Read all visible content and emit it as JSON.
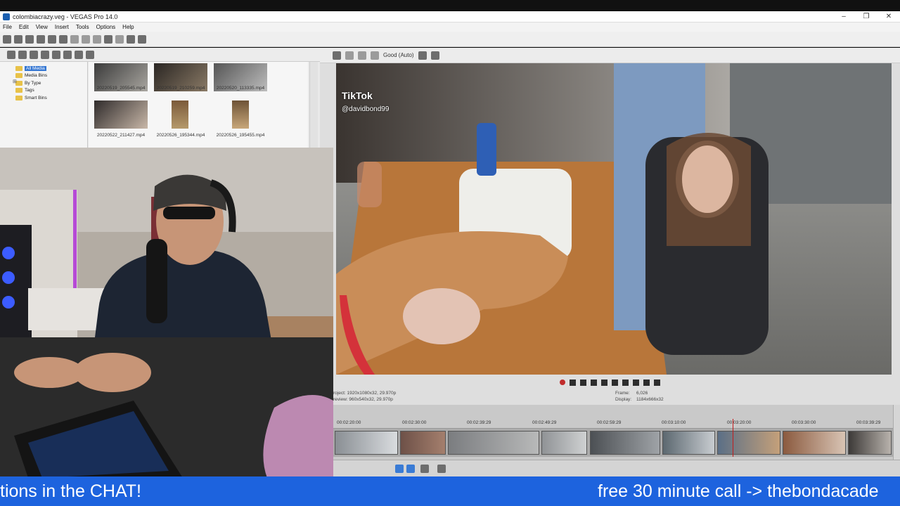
{
  "window": {
    "title": "colombiacrazy.veg - VEGAS Pro 14.0",
    "controls": [
      "–",
      "❐",
      "✕"
    ]
  },
  "menu": [
    "File",
    "Edit",
    "View",
    "Insert",
    "Tools",
    "Options",
    "Help"
  ],
  "explorer": {
    "tree": [
      {
        "label": "All Media",
        "selected": true
      },
      {
        "label": "Media Bins",
        "selected": false
      },
      {
        "label": "By Type",
        "selected": false
      },
      {
        "label": "Tags",
        "selected": false
      },
      {
        "label": "Smart Bins",
        "selected": false
      }
    ],
    "media_files": [
      "20220519_205545.mp4",
      "20220519_210259.mp4",
      "20220520_113335.mp4",
      "20220522_211427.mp4",
      "20220526_195344.mp4",
      "20220526_195455.mp4"
    ]
  },
  "preview": {
    "quality": "Good (Auto)",
    "watermark_brand": "TikTok",
    "watermark_user": "@davidbond99",
    "project_line": "roject:  1920x1080x32, 29.970p",
    "preview_line": "review:  960x540x32, 29.970p",
    "frame_label": "Frame:",
    "frame_value": "6,026",
    "display_label": "Display:",
    "display_value": "1184x666x32"
  },
  "timeline": {
    "ruler": [
      "00:02:20:00",
      "00:02:30:00",
      "00:02:39:29",
      "00:02:49:29",
      "00:02:59:29",
      "00:03:10:00",
      "00:03:20:00",
      "00:03:30:00",
      "00:03:39:29"
    ]
  },
  "ticker": {
    "text_left": "tions in the CHAT!",
    "text_right": "free 30 minute call -> thebondacade"
  },
  "colors": {
    "ticker_bg": "#1d63de",
    "vegas_accent": "#1b5fb0",
    "record": "#c02b2b"
  }
}
